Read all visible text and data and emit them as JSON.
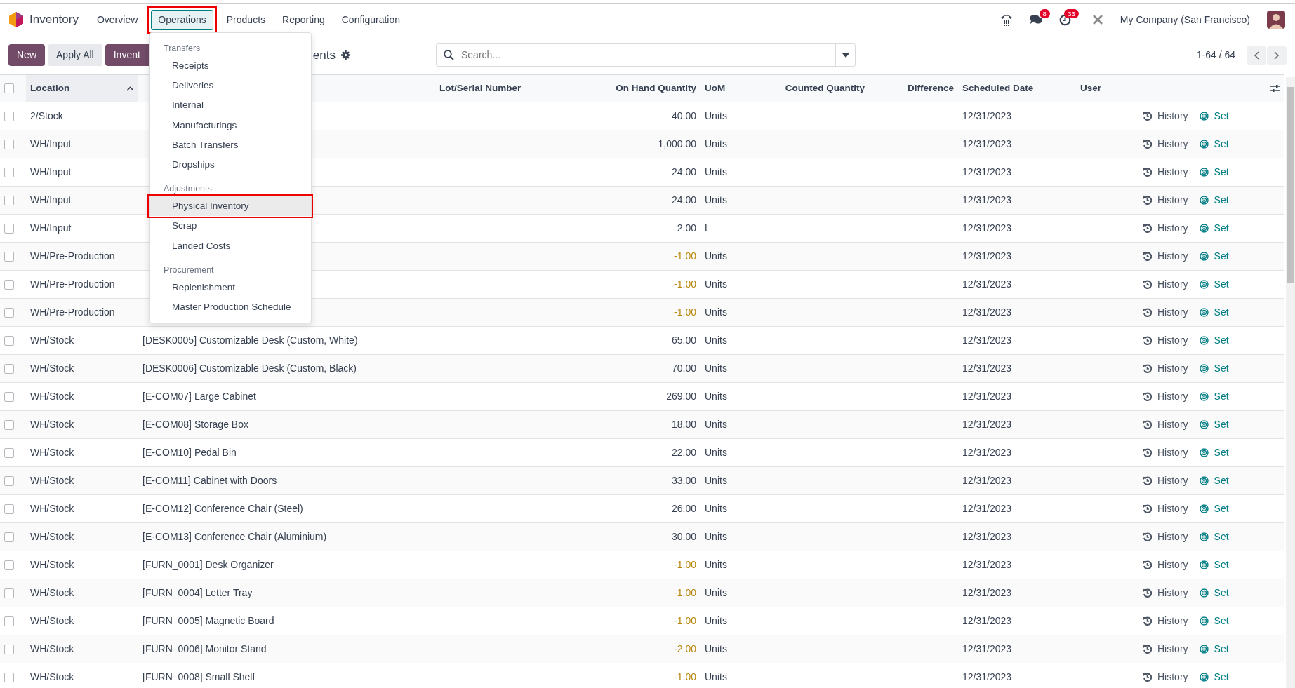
{
  "navbar": {
    "app": "Inventory",
    "menus": [
      {
        "label": "Overview",
        "selected": false
      },
      {
        "label": "Operations",
        "selected": true,
        "highlighted": true
      },
      {
        "label": "Products",
        "selected": false
      },
      {
        "label": "Reporting",
        "selected": false
      },
      {
        "label": "Configuration",
        "selected": false
      }
    ],
    "messages_badge": "8",
    "activities_badge": "33",
    "company": "My Company (San Francisco)"
  },
  "control_panel": {
    "buttons": [
      {
        "label": "New",
        "kind": "primary"
      },
      {
        "label": "Apply All",
        "kind": "secondary"
      },
      {
        "label": "Invent",
        "kind": "primary"
      }
    ],
    "title": "ents",
    "search": {
      "placeholder": "Search..."
    },
    "pager": "1-64 / 64"
  },
  "dropdown": {
    "sections": [
      {
        "header": "Transfers",
        "items": [
          {
            "label": "Receipts",
            "selected": false
          },
          {
            "label": "Deliveries",
            "selected": false
          },
          {
            "label": "Internal",
            "selected": false
          },
          {
            "label": "Manufacturings",
            "selected": false
          },
          {
            "label": "Batch Transfers",
            "selected": false
          },
          {
            "label": "Dropships",
            "selected": false
          }
        ]
      },
      {
        "header": "Adjustments",
        "items": [
          {
            "label": "Physical Inventory",
            "selected": true
          },
          {
            "label": "Scrap",
            "selected": false
          },
          {
            "label": "Landed Costs",
            "selected": false
          }
        ]
      },
      {
        "header": "Procurement",
        "items": [
          {
            "label": "Replenishment",
            "selected": false
          },
          {
            "label": "Master Production Schedule",
            "selected": false
          }
        ]
      }
    ]
  },
  "table": {
    "select_all_checked": false,
    "columns": [
      {
        "label": "Location",
        "sorted": true
      },
      {
        "label": "Lot/Serial Number",
        "sorted": false
      },
      {
        "label": "On Hand Quantity",
        "sorted": false
      },
      {
        "label": "UoM",
        "sorted": false
      },
      {
        "label": "Counted Quantity",
        "sorted": false
      },
      {
        "label": "Difference",
        "sorted": false
      },
      {
        "label": "Scheduled Date",
        "sorted": false
      },
      {
        "label": "User",
        "sorted": false
      }
    ],
    "rows": [
      {
        "checked": false,
        "location": "2/Stock",
        "on_hand": "40.00",
        "uom": "Units",
        "negative": false,
        "date": "12/31/2023",
        "history": "History",
        "set": "Set"
      },
      {
        "checked": false,
        "location": "WH/Input",
        "on_hand": "1,000.00",
        "uom": "Units",
        "negative": false,
        "date": "12/31/2023",
        "history": "History",
        "set": "Set"
      },
      {
        "checked": false,
        "location": "WH/Input",
        "on_hand": "24.00",
        "uom": "Units",
        "negative": false,
        "date": "12/31/2023",
        "history": "History",
        "set": "Set"
      },
      {
        "checked": false,
        "location": "WH/Input",
        "on_hand": "24.00",
        "uom": "Units",
        "negative": false,
        "date": "12/31/2023",
        "history": "History",
        "set": "Set"
      },
      {
        "checked": false,
        "location": "WH/Input",
        "on_hand": "2.00",
        "uom": "L",
        "negative": false,
        "date": "12/31/2023",
        "history": "History",
        "set": "Set"
      },
      {
        "checked": false,
        "location": "WH/Pre-Production",
        "on_hand": "-1.00",
        "uom": "Units",
        "negative": true,
        "date": "12/31/2023",
        "history": "History",
        "set": "Set"
      },
      {
        "checked": false,
        "location": "WH/Pre-Production",
        "on_hand": "-1.00",
        "uom": "Units",
        "negative": true,
        "date": "12/31/2023",
        "history": "History",
        "set": "Set"
      },
      {
        "checked": false,
        "location": "WH/Pre-Production",
        "on_hand": "-1.00",
        "uom": "Units",
        "negative": true,
        "date": "12/31/2023",
        "history": "History",
        "set": "Set"
      },
      {
        "checked": false,
        "location": "WH/Stock",
        "product": "[DESK0005] Customizable Desk (Custom, White)",
        "on_hand": "65.00",
        "uom": "Units",
        "negative": false,
        "date": "12/31/2023",
        "history": "History",
        "set": "Set"
      },
      {
        "checked": false,
        "location": "WH/Stock",
        "product": "[DESK0006] Customizable Desk (Custom, Black)",
        "on_hand": "70.00",
        "uom": "Units",
        "negative": false,
        "date": "12/31/2023",
        "history": "History",
        "set": "Set"
      },
      {
        "checked": false,
        "location": "WH/Stock",
        "product": "[E-COM07] Large Cabinet",
        "on_hand": "269.00",
        "uom": "Units",
        "negative": false,
        "date": "12/31/2023",
        "history": "History",
        "set": "Set"
      },
      {
        "checked": false,
        "location": "WH/Stock",
        "product": "[E-COM08] Storage Box",
        "on_hand": "18.00",
        "uom": "Units",
        "negative": false,
        "date": "12/31/2023",
        "history": "History",
        "set": "Set"
      },
      {
        "checked": false,
        "location": "WH/Stock",
        "product": "[E-COM10] Pedal Bin",
        "on_hand": "22.00",
        "uom": "Units",
        "negative": false,
        "date": "12/31/2023",
        "history": "History",
        "set": "Set"
      },
      {
        "checked": false,
        "location": "WH/Stock",
        "product": "[E-COM11] Cabinet with Doors",
        "on_hand": "33.00",
        "uom": "Units",
        "negative": false,
        "date": "12/31/2023",
        "history": "History",
        "set": "Set"
      },
      {
        "checked": false,
        "location": "WH/Stock",
        "product": "[E-COM12] Conference Chair (Steel)",
        "on_hand": "26.00",
        "uom": "Units",
        "negative": false,
        "date": "12/31/2023",
        "history": "History",
        "set": "Set"
      },
      {
        "checked": false,
        "location": "WH/Stock",
        "product": "[E-COM13] Conference Chair (Aluminium)",
        "on_hand": "30.00",
        "uom": "Units",
        "negative": false,
        "date": "12/31/2023",
        "history": "History",
        "set": "Set"
      },
      {
        "checked": false,
        "location": "WH/Stock",
        "product": "[FURN_0001] Desk Organizer",
        "on_hand": "-1.00",
        "uom": "Units",
        "negative": true,
        "date": "12/31/2023",
        "history": "History",
        "set": "Set"
      },
      {
        "checked": false,
        "location": "WH/Stock",
        "product": "[FURN_0004] Letter Tray",
        "on_hand": "-1.00",
        "uom": "Units",
        "negative": true,
        "date": "12/31/2023",
        "history": "History",
        "set": "Set"
      },
      {
        "checked": false,
        "location": "WH/Stock",
        "product": "[FURN_0005] Magnetic Board",
        "on_hand": "-1.00",
        "uom": "Units",
        "negative": true,
        "date": "12/31/2023",
        "history": "History",
        "set": "Set"
      },
      {
        "checked": false,
        "location": "WH/Stock",
        "product": "[FURN_0006] Monitor Stand",
        "on_hand": "-2.00",
        "uom": "Units",
        "negative": true,
        "date": "12/31/2023",
        "history": "History",
        "set": "Set"
      },
      {
        "checked": false,
        "location": "WH/Stock",
        "product": "[FURN_0008] Small Shelf",
        "on_hand": "-1.00",
        "uom": "Units",
        "negative": true,
        "date": "12/31/2023",
        "history": "History",
        "set": "Set"
      }
    ]
  }
}
